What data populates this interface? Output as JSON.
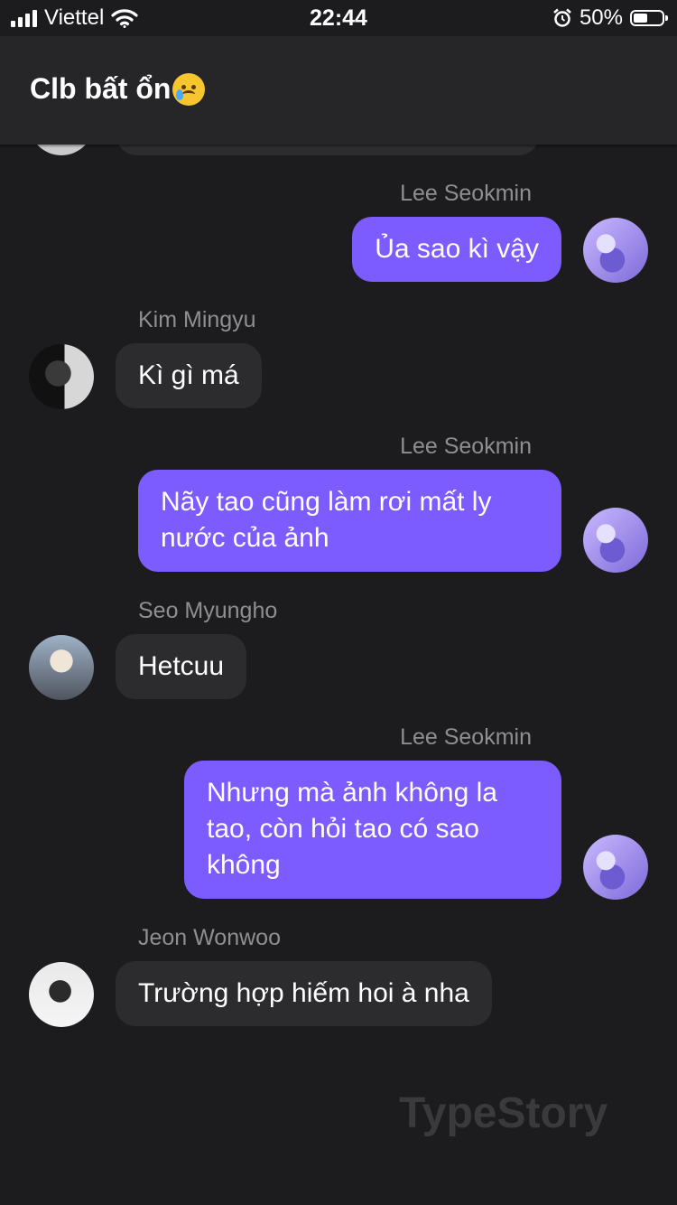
{
  "status": {
    "carrier": "Viettel",
    "time": "22:44",
    "battery": "50%",
    "battery_level": 0.5
  },
  "header": {
    "title": "Clb bất ổn",
    "emoji": "crying-face-emoji"
  },
  "messages": [
    {
      "sender": "Lee Seokmin",
      "text": "Ủa sao kì vậy",
      "direction": "outgoing"
    },
    {
      "sender": "Kim Mingyu",
      "text": "Kì gì má",
      "direction": "incoming"
    },
    {
      "sender": "Lee Seokmin",
      "text": "Nãy tao cũng làm rơi mất ly nước của ảnh",
      "direction": "outgoing"
    },
    {
      "sender": "Seo Myungho",
      "text": "Hetcuu",
      "direction": "incoming"
    },
    {
      "sender": "Lee Seokmin",
      "text": "Nhưng mà ảnh không la tao, còn hỏi tao có sao không",
      "direction": "outgoing"
    },
    {
      "sender": "Jeon Wonwoo",
      "text": "Trường hợp hiếm hoi à nha",
      "direction": "incoming"
    }
  ],
  "watermark": "TypeStory",
  "colors": {
    "outgoing_bubble": "#7c5cff",
    "incoming_bubble": "#2c2c2e",
    "background": "#1c1c1e"
  }
}
